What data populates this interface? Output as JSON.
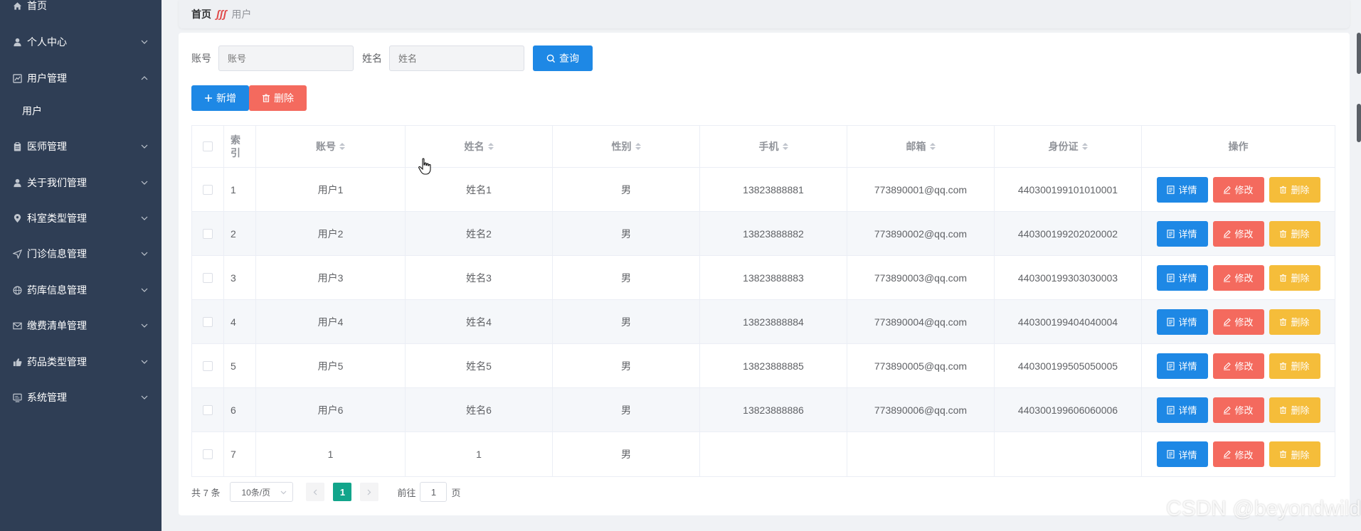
{
  "sidebar": {
    "items": [
      {
        "label": "首页",
        "icon": "home-icon",
        "has_arrow": false
      },
      {
        "label": "个人中心",
        "icon": "user-icon",
        "has_arrow": true,
        "expanded": false
      },
      {
        "label": "用户管理",
        "icon": "chart-icon",
        "has_arrow": true,
        "expanded": true
      },
      {
        "label": "医师管理",
        "icon": "clipboard-icon",
        "has_arrow": true,
        "expanded": false
      },
      {
        "label": "关于我们管理",
        "icon": "user-icon",
        "has_arrow": true,
        "expanded": false
      },
      {
        "label": "科室类型管理",
        "icon": "location-icon",
        "has_arrow": true,
        "expanded": false
      },
      {
        "label": "门诊信息管理",
        "icon": "send-icon",
        "has_arrow": true,
        "expanded": false
      },
      {
        "label": "药库信息管理",
        "icon": "globe-icon",
        "has_arrow": true,
        "expanded": false
      },
      {
        "label": "缴费清单管理",
        "icon": "mail-icon",
        "has_arrow": true,
        "expanded": false
      },
      {
        "label": "药品类型管理",
        "icon": "thumb-icon",
        "has_arrow": true,
        "expanded": false
      },
      {
        "label": "系统管理",
        "icon": "monitor-icon",
        "has_arrow": true,
        "expanded": false
      }
    ],
    "submenu": {
      "label": "用户"
    }
  },
  "breadcrumb": {
    "home": "首页",
    "separator": "ʃʃʃ",
    "current": "用户"
  },
  "search": {
    "account_label": "账号",
    "account_placeholder": "账号",
    "name_label": "姓名",
    "name_placeholder": "姓名",
    "query_label": "查询"
  },
  "actions": {
    "add_label": "新增",
    "delete_label": "删除"
  },
  "table": {
    "headers": {
      "index": "索引",
      "account": "账号",
      "name": "姓名",
      "gender": "性别",
      "phone": "手机",
      "email": "邮箱",
      "id_card": "身份证",
      "operations": "操作"
    },
    "row_buttons": {
      "detail": "详情",
      "edit": "修改",
      "delete": "删除"
    },
    "rows": [
      {
        "index": "1",
        "account": "用户1",
        "name": "姓名1",
        "gender": "男",
        "phone": "13823888881",
        "email": "773890001@qq.com",
        "id_card": "440300199101010001"
      },
      {
        "index": "2",
        "account": "用户2",
        "name": "姓名2",
        "gender": "男",
        "phone": "13823888882",
        "email": "773890002@qq.com",
        "id_card": "440300199202020002"
      },
      {
        "index": "3",
        "account": "用户3",
        "name": "姓名3",
        "gender": "男",
        "phone": "13823888883",
        "email": "773890003@qq.com",
        "id_card": "440300199303030003"
      },
      {
        "index": "4",
        "account": "用户4",
        "name": "姓名4",
        "gender": "男",
        "phone": "13823888884",
        "email": "773890004@qq.com",
        "id_card": "440300199404040004"
      },
      {
        "index": "5",
        "account": "用户5",
        "name": "姓名5",
        "gender": "男",
        "phone": "13823888885",
        "email": "773890005@qq.com",
        "id_card": "440300199505050005"
      },
      {
        "index": "6",
        "account": "用户6",
        "name": "姓名6",
        "gender": "男",
        "phone": "13823888886",
        "email": "773890006@qq.com",
        "id_card": "440300199606060006"
      },
      {
        "index": "7",
        "account": "1",
        "name": "1",
        "gender": "男",
        "phone": "",
        "email": "",
        "id_card": ""
      }
    ]
  },
  "pagination": {
    "total_text": "共 7 条",
    "page_size": "10条/页",
    "current_page": "1",
    "goto_prefix": "前往",
    "goto_value": "1",
    "goto_suffix": "页"
  },
  "watermark": "CSDN @beyondwild",
  "colors": {
    "sidebar_bg": "#2f3e55",
    "primary": "#1e88e5",
    "danger": "#f46a5e",
    "warning": "#f5bd3a",
    "pager_active": "#12a58b"
  }
}
